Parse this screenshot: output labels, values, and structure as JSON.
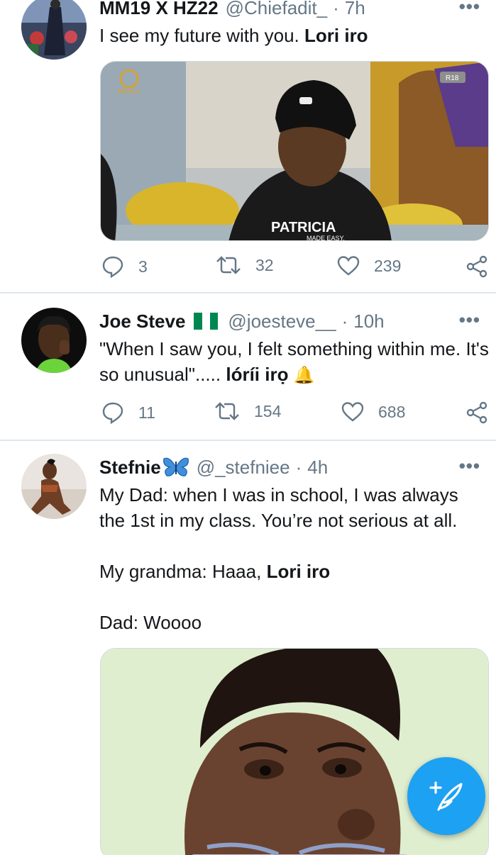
{
  "tweets": [
    {
      "name": "MM19 X HZ22",
      "handle": "@Chiefadit_",
      "dot": "·",
      "time": "7h",
      "text_plain": "I see my future with you. ",
      "text_bold": "Lori iro",
      "image_badge_left": "BBNAIJA",
      "image_badge_right": "R18",
      "image_shirt_text": "PATRICIA",
      "image_shirt_sub": "MADE EASY.",
      "replies": "3",
      "retweets": "32",
      "likes": "239"
    },
    {
      "name": "Joe Steve",
      "handle": "@joesteve__",
      "dot": "·",
      "time": "10h",
      "text_plain": "\"When I saw you, I felt something within me. It's so unusual\"..... ",
      "text_bold": "lóríi irọ",
      "emoji": "🔔",
      "replies": "11",
      "retweets": "154",
      "likes": "688"
    },
    {
      "name": "Stefnie",
      "handle": "@_stefniee",
      "dot": "·",
      "time": "4h",
      "line1": "My Dad: when I was in school, I was always the 1st in my class. You’re not serious at all.",
      "line2_plain": "My grandma: Haaa, ",
      "line2_bold": "Lori iro",
      "line3": "Dad: Woooo"
    }
  ],
  "more_label": "•••",
  "icons": {
    "reply": "reply-icon",
    "retweet": "retweet-icon",
    "like": "heart-icon",
    "share": "share-icon",
    "compose": "compose-tweet-icon",
    "flag": "nigeria-flag-icon",
    "butterfly": "butterfly-icon"
  },
  "colors": {
    "accent": "#1da1f2",
    "muted": "#657786",
    "text": "#14171a",
    "flag_green": "#008751"
  }
}
